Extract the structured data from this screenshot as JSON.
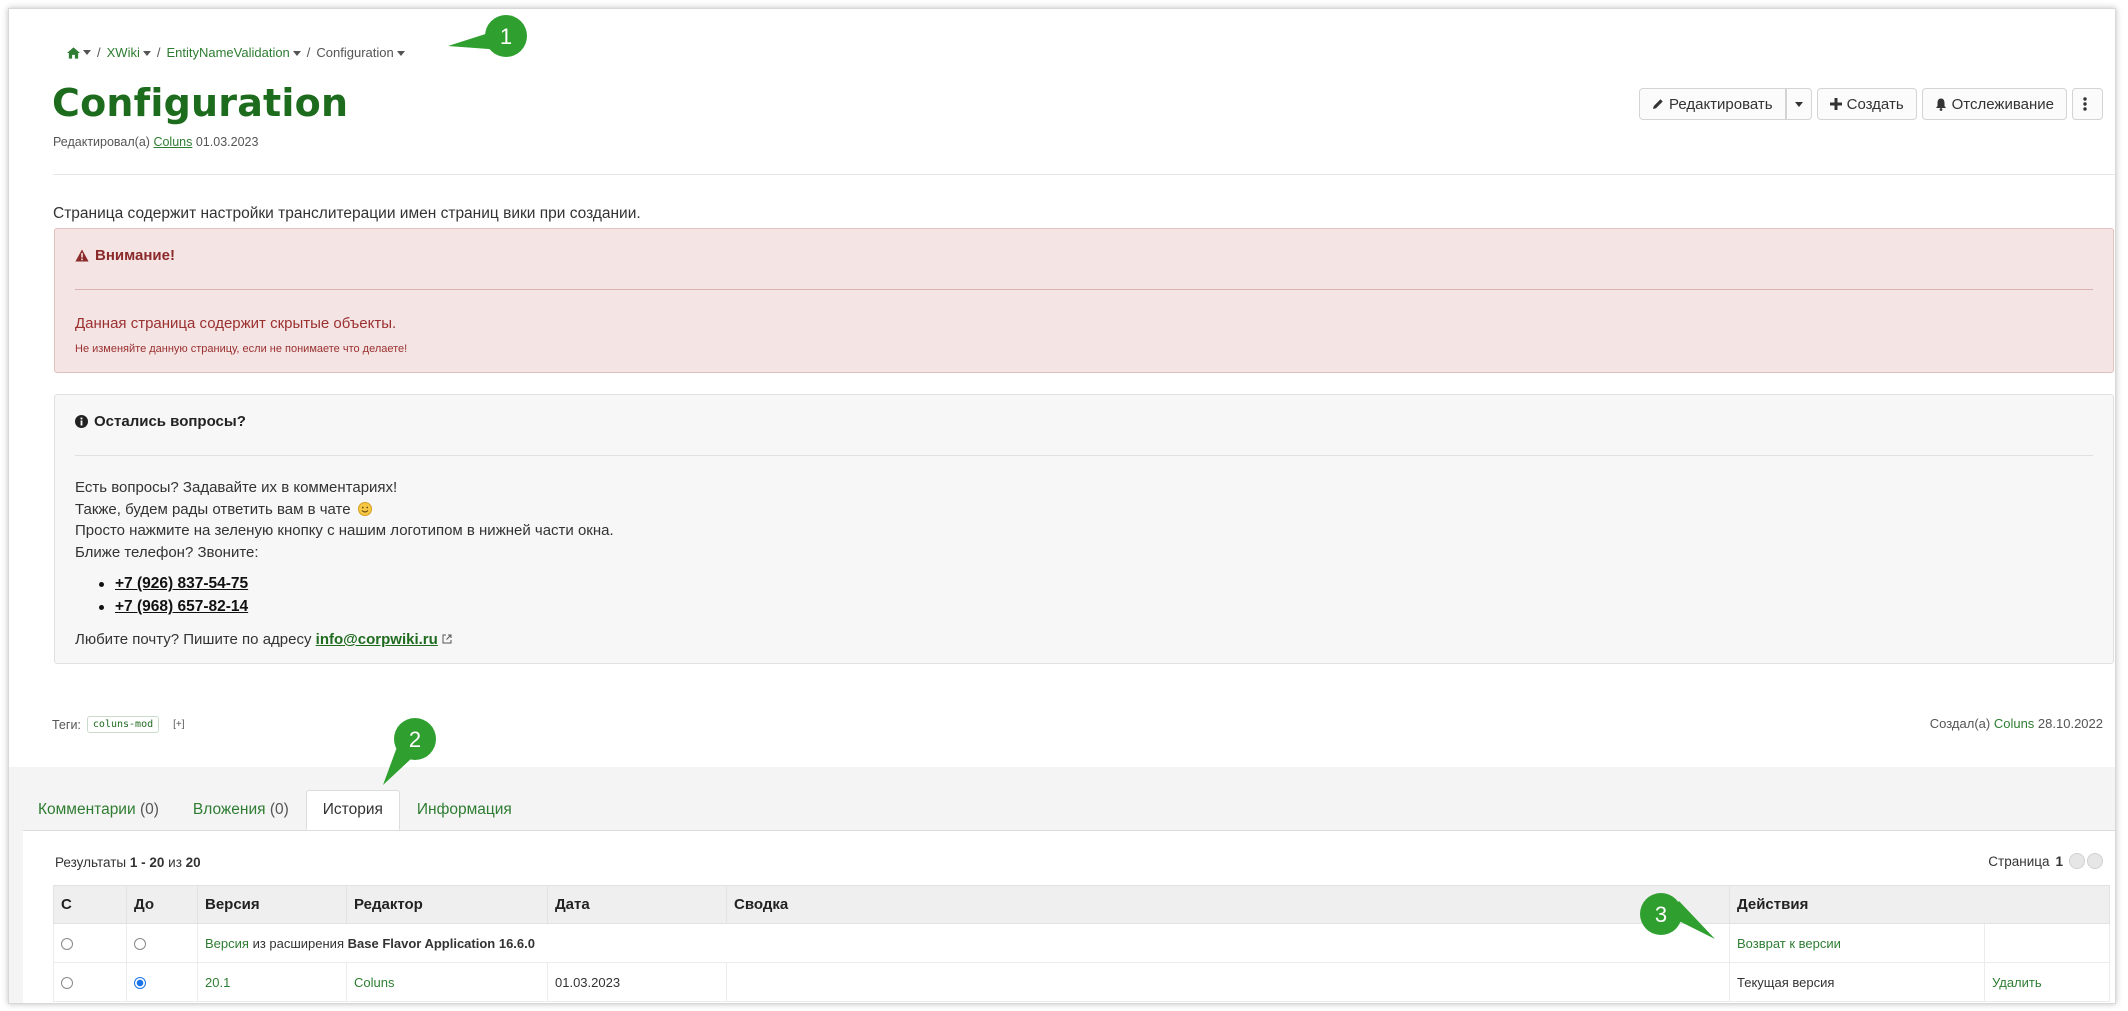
{
  "breadcrumb": {
    "items": [
      "XWiki",
      "EntityNameValidation",
      "Configuration"
    ]
  },
  "page": {
    "title": "Configuration",
    "edited_prefix": "Редактировал(а)",
    "edited_user": "Coluns",
    "edited_date": "01.03.2023",
    "description": "Страница содержит настройки транслитерации имен страниц вики при создании."
  },
  "toolbar": {
    "edit_label": "Редактировать",
    "create_label": "Создать",
    "watch_label": "Отслеживание"
  },
  "warning": {
    "title": "Внимание!",
    "message": "Данная страница содержит скрытые объекты.",
    "submessage": "Не изменяйте данную страницу, если не понимаете что делаете!"
  },
  "info": {
    "title": "Остались вопросы?",
    "line1": "Есть вопросы? Задавайте их в комментариях!",
    "line2": "Также, будем рады ответить вам в чате",
    "line3": "Просто нажмите на зеленую кнопку с нашим логотипом в нижней части окна.",
    "line4": "Ближе телефон? Звоните:",
    "phones": [
      "+7 (926) 837-54-75",
      "+7 (968) 657-82-14"
    ],
    "email_prefix": "Любите почту? Пишите по адресу",
    "email": "info@corpwiki.ru"
  },
  "tags": {
    "label": "Теги:",
    "items": [
      "coluns-mod"
    ],
    "add": "[+]"
  },
  "created": {
    "prefix": "Создал(а)",
    "user": "Coluns",
    "date": "28.10.2022"
  },
  "tabs": [
    {
      "label": "Комментарии",
      "count": "(0)"
    },
    {
      "label": "Вложения",
      "count": "(0)"
    },
    {
      "label": "История",
      "count": ""
    },
    {
      "label": "Информация",
      "count": ""
    }
  ],
  "history": {
    "results_prefix": "Результаты",
    "results_range": "1 - 20",
    "results_of": "из",
    "results_total": "20",
    "page_label": "Страница",
    "page_num": "1",
    "columns": [
      "С",
      "До",
      "Версия",
      "Редактор",
      "Дата",
      "Сводка",
      "Действия"
    ],
    "rows": [
      {
        "version_link": "Версия",
        "version_text": "из расширения",
        "version_bold": "Base Flavor Application 16.6.0",
        "action": "Возврат к версии",
        "action2": ""
      },
      {
        "version": "20.1",
        "editor": "Coluns",
        "date": "01.03.2023",
        "summary": "",
        "action": "Текущая версия",
        "action2": "Удалить"
      }
    ]
  },
  "markers": [
    "1",
    "2",
    "3"
  ],
  "colors": {
    "brand_green": "#1d6b1d",
    "link_green": "#2e7d32",
    "warning_bg": "#f5e4e4",
    "warning_text": "#9a3030",
    "marker_green": "#2fa02f"
  }
}
